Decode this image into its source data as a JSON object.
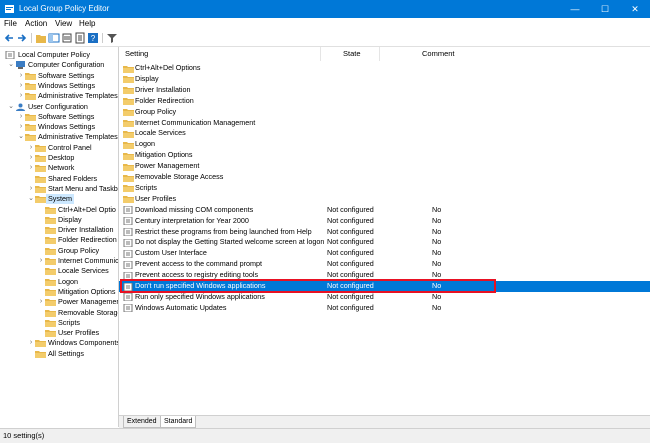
{
  "window": {
    "title": "Local Group Policy Editor",
    "minimize": "—",
    "maximize": "☐",
    "close": "✕"
  },
  "menu": [
    "File",
    "Action",
    "View",
    "Help"
  ],
  "tree": [
    {
      "label": "Local Computer Policy",
      "icon": "computer-policy-icon",
      "chev": ""
    },
    {
      "label": "Computer Configuration",
      "icon": "computer-icon",
      "chev": "⌄"
    },
    {
      "label": "Software Settings",
      "icon": "folder-icon",
      "chev": "›"
    },
    {
      "label": "Windows Settings",
      "icon": "folder-icon",
      "chev": "›"
    },
    {
      "label": "Administrative Templates",
      "icon": "folder-icon",
      "chev": "›"
    },
    {
      "label": "User Configuration",
      "icon": "user-icon",
      "chev": "⌄"
    },
    {
      "label": "Software Settings",
      "icon": "folder-icon",
      "chev": "›"
    },
    {
      "label": "Windows Settings",
      "icon": "folder-icon",
      "chev": "›"
    },
    {
      "label": "Administrative Templates",
      "icon": "folder-icon",
      "chev": "⌄"
    },
    {
      "label": "Control Panel",
      "icon": "folder-icon",
      "chev": "›"
    },
    {
      "label": "Desktop",
      "icon": "folder-icon",
      "chev": "›"
    },
    {
      "label": "Network",
      "icon": "folder-icon",
      "chev": "›"
    },
    {
      "label": "Shared Folders",
      "icon": "folder-icon",
      "chev": ""
    },
    {
      "label": "Start Menu and Taskba",
      "icon": "folder-icon",
      "chev": "›"
    },
    {
      "label": "System",
      "icon": "folder-icon",
      "chev": "⌄"
    },
    {
      "label": "Ctrl+Alt+Del Optio",
      "icon": "folder-icon",
      "chev": ""
    },
    {
      "label": "Display",
      "icon": "folder-icon",
      "chev": ""
    },
    {
      "label": "Driver Installation",
      "icon": "folder-icon",
      "chev": ""
    },
    {
      "label": "Folder Redirection",
      "icon": "folder-icon",
      "chev": ""
    },
    {
      "label": "Group Policy",
      "icon": "folder-icon",
      "chev": ""
    },
    {
      "label": "Internet Communic",
      "icon": "folder-icon",
      "chev": "›"
    },
    {
      "label": "Locale Services",
      "icon": "folder-icon",
      "chev": ""
    },
    {
      "label": "Logon",
      "icon": "folder-icon",
      "chev": ""
    },
    {
      "label": "Mitigation Options",
      "icon": "folder-icon",
      "chev": ""
    },
    {
      "label": "Power Managemer",
      "icon": "folder-icon",
      "chev": "›"
    },
    {
      "label": "Removable Storage",
      "icon": "folder-icon",
      "chev": ""
    },
    {
      "label": "Scripts",
      "icon": "folder-icon",
      "chev": ""
    },
    {
      "label": "User Profiles",
      "icon": "folder-icon",
      "chev": ""
    },
    {
      "label": "Windows Components",
      "icon": "folder-icon",
      "chev": "›"
    },
    {
      "label": "All Settings",
      "icon": "folder-icon",
      "chev": ""
    }
  ],
  "columns": {
    "setting": "Setting",
    "state": "State",
    "comment": "Comment"
  },
  "rows": [
    {
      "name": "Ctrl+Alt+Del Options",
      "state": "",
      "comment": "",
      "type": "folder"
    },
    {
      "name": "Display",
      "state": "",
      "comment": "",
      "type": "folder"
    },
    {
      "name": "Driver Installation",
      "state": "",
      "comment": "",
      "type": "folder"
    },
    {
      "name": "Folder Redirection",
      "state": "",
      "comment": "",
      "type": "folder"
    },
    {
      "name": "Group Policy",
      "state": "",
      "comment": "",
      "type": "folder"
    },
    {
      "name": "Internet Communication Management",
      "state": "",
      "comment": "",
      "type": "folder"
    },
    {
      "name": "Locale Services",
      "state": "",
      "comment": "",
      "type": "folder"
    },
    {
      "name": "Logon",
      "state": "",
      "comment": "",
      "type": "folder"
    },
    {
      "name": "Mitigation Options",
      "state": "",
      "comment": "",
      "type": "folder"
    },
    {
      "name": "Power Management",
      "state": "",
      "comment": "",
      "type": "folder"
    },
    {
      "name": "Removable Storage Access",
      "state": "",
      "comment": "",
      "type": "folder"
    },
    {
      "name": "Scripts",
      "state": "",
      "comment": "",
      "type": "folder"
    },
    {
      "name": "User Profiles",
      "state": "",
      "comment": "",
      "type": "folder"
    },
    {
      "name": "Download missing COM components",
      "state": "Not configured",
      "comment": "No",
      "type": "policy"
    },
    {
      "name": "Century interpretation for Year 2000",
      "state": "Not configured",
      "comment": "No",
      "type": "policy"
    },
    {
      "name": "Restrict these programs from being launched from Help",
      "state": "Not configured",
      "comment": "No",
      "type": "policy"
    },
    {
      "name": "Do not display the Getting Started welcome screen at logon",
      "state": "Not configured",
      "comment": "No",
      "type": "policy"
    },
    {
      "name": "Custom User Interface",
      "state": "Not configured",
      "comment": "No",
      "type": "policy"
    },
    {
      "name": "Prevent access to the command prompt",
      "state": "Not configured",
      "comment": "No",
      "type": "policy"
    },
    {
      "name": "Prevent access to registry editing tools",
      "state": "Not configured",
      "comment": "No",
      "type": "policy"
    },
    {
      "name": "Don't run specified Windows applications",
      "state": "Not configured",
      "comment": "No",
      "type": "policy"
    },
    {
      "name": "Run only specified Windows applications",
      "state": "Not configured",
      "comment": "No",
      "type": "policy"
    },
    {
      "name": "Windows Automatic Updates",
      "state": "Not configured",
      "comment": "No",
      "type": "policy"
    }
  ],
  "tabs": {
    "extended": "Extended",
    "standard": "Standard"
  },
  "status": "10 setting(s)",
  "colors": {
    "accent": "#0078d7",
    "highlight_border": "#e81123",
    "folder": "#e8b84a"
  }
}
